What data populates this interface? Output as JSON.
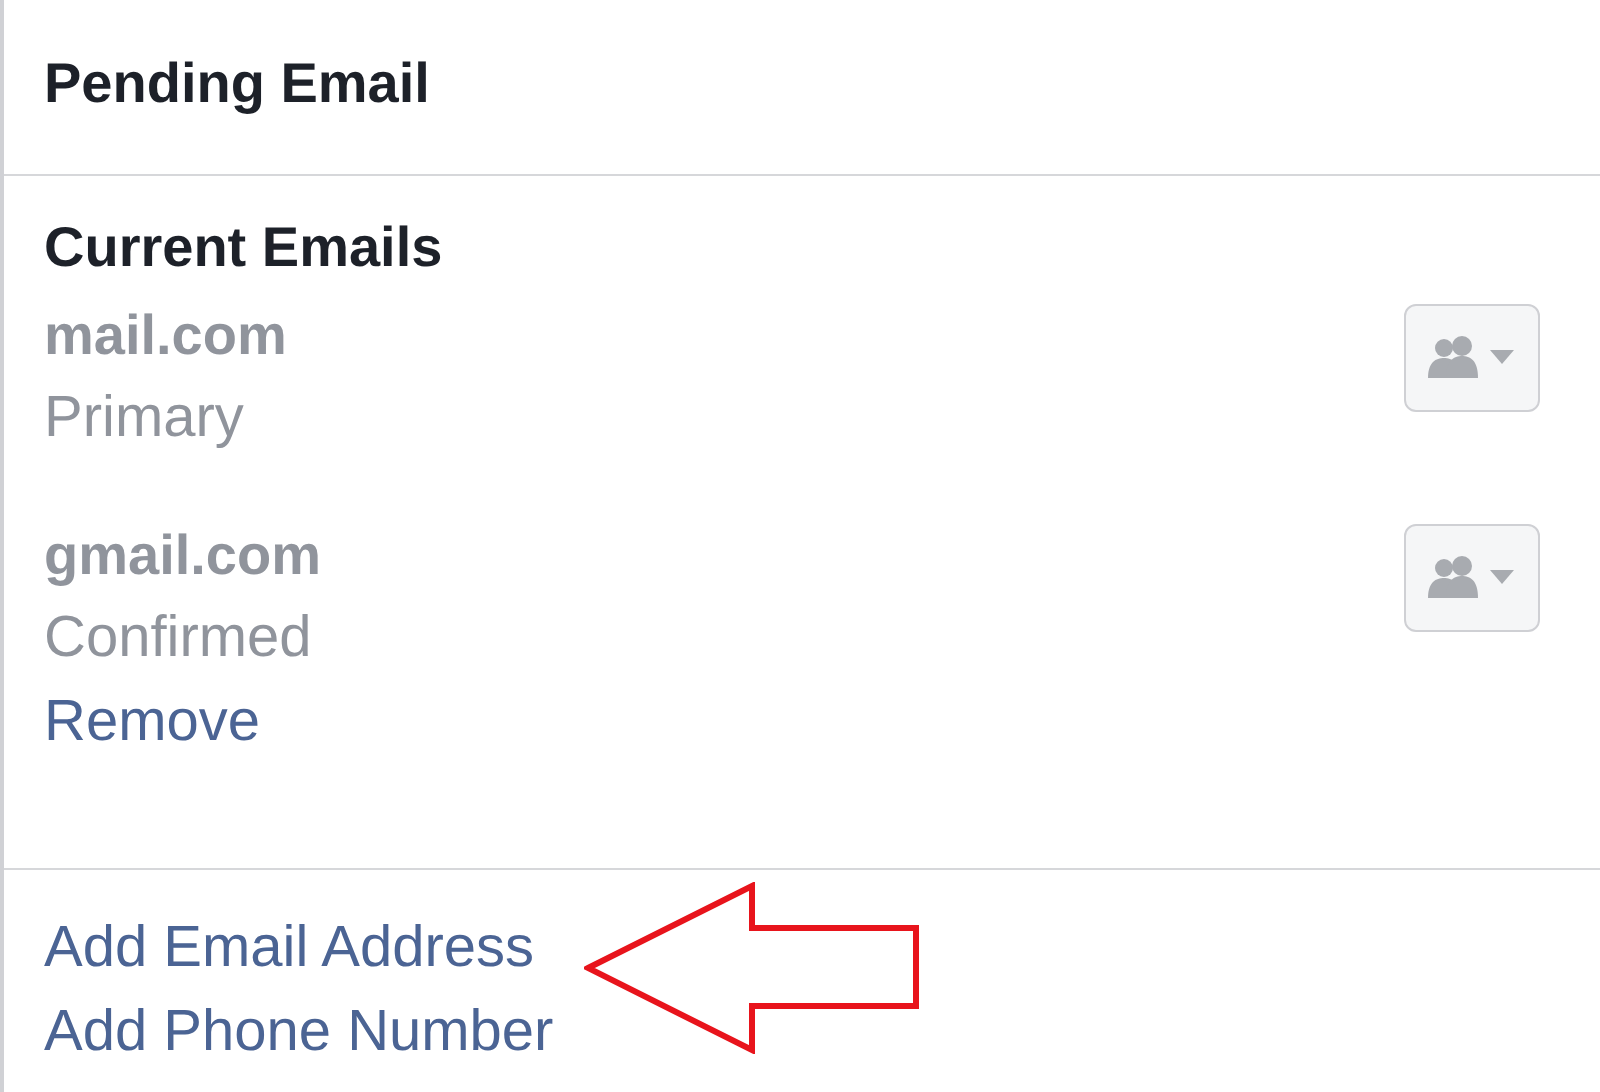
{
  "pending_section": {
    "title": "Pending Email"
  },
  "current_section": {
    "title": "Current Emails",
    "emails": [
      {
        "address": "mail.com",
        "status": "Primary"
      },
      {
        "address": "gmail.com",
        "status": "Confirmed",
        "actions": [
          "Remove"
        ]
      }
    ]
  },
  "add_links": [
    "Add Email Address",
    "Add Phone Number"
  ],
  "annotation": {
    "kind": "arrow",
    "color": "#e8141c"
  }
}
